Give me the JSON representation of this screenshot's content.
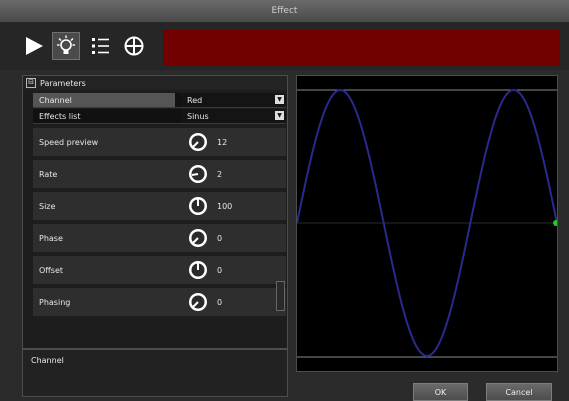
{
  "window": {
    "title": "Effect"
  },
  "toolbar": {
    "buttons": [
      {
        "icon": "play-icon"
      },
      {
        "icon": "light-bulb-icon"
      },
      {
        "icon": "list-icon"
      },
      {
        "icon": "move-position-icon"
      }
    ],
    "banner_color": "#720000"
  },
  "parameters": {
    "group_title": "Parameters",
    "expander": "⊟",
    "channel": {
      "label": "Channel",
      "value": "Red"
    },
    "effect": {
      "label": "Effects list",
      "value": "Sinus"
    },
    "speed_preview": {
      "label": "Speed preview",
      "value": "12"
    },
    "rate": {
      "label": "Rate",
      "value": "2"
    },
    "size": {
      "label": "Size",
      "value": "100"
    },
    "phase": {
      "label": "Phase",
      "value": "0"
    },
    "offset": {
      "label": "Offset",
      "value": "0"
    },
    "phasing": {
      "label": "Phasing",
      "value": "0"
    }
  },
  "help": {
    "title": "Channel"
  },
  "graph": {
    "function": "sine",
    "periods": 1.5,
    "line_color": "#2a2a8c",
    "marker_color": "#22cc22"
  },
  "buttons": {
    "ok": "OK",
    "cancel": "Cancel"
  }
}
